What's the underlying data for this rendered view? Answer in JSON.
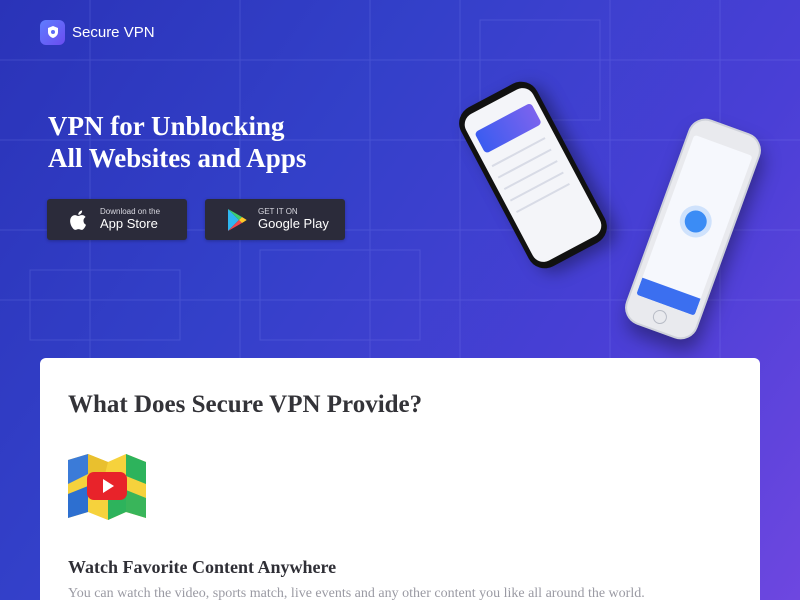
{
  "brand": {
    "name": "Secure VPN",
    "logo_icon": "shield-icon"
  },
  "hero": {
    "title_line1": "VPN for Unblocking",
    "title_line2": "All Websites and Apps"
  },
  "stores": {
    "apple": {
      "small": "Download on the",
      "big": "App Store",
      "icon": "apple-icon"
    },
    "google": {
      "small": "GET IT ON",
      "big": "Google Play",
      "icon": "google-play-icon"
    }
  },
  "colors": {
    "accent": "#3b5cf0",
    "button_bg": "#2b2b3a"
  },
  "section": {
    "title": "What Does Secure VPN Provide?",
    "feature": {
      "icon": "youtube-map-icon",
      "title": "Watch Favorite Content Anywhere",
      "description": "You can watch the video, sports match, live events and any other content you like all around the world."
    }
  }
}
